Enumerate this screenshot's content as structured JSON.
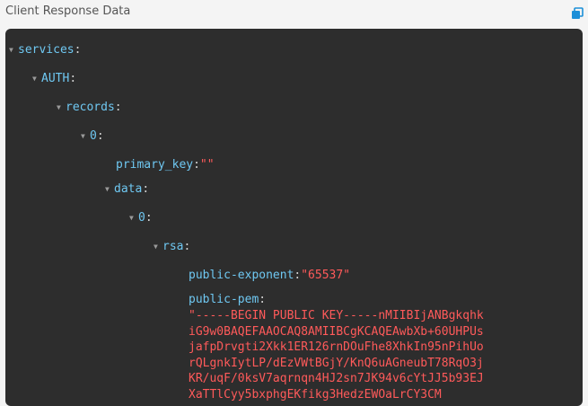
{
  "header": {
    "title": "Client Response Data",
    "copy_icon": "copy-icon"
  },
  "tree": {
    "services_key": "services",
    "auth_key": "AUTH",
    "records_key": "records",
    "index0_key": "0",
    "primary_key_key": "primary_key",
    "primary_key_value": "\"\"",
    "data_key": "data",
    "data_index0_key": "0",
    "rsa_key": "rsa",
    "public_exponent_key": "public-exponent",
    "public_exponent_value": "\"65537\"",
    "public_pem_key": "public-pem",
    "public_pem_value": "\"-----BEGIN PUBLIC KEY-----nMIIBIjANBgkqhkiG9w0BAQEFAAOCAQ8AMIIBCgKCAQEAwbXb+60UHPUsjafpDrvgti2Xkk1ER126rnDOuFhe8XhkIn95nPihUorQLgnkIytLP/dEzVWtBGjY/KnQ6uAGneubT78RqO3jKR/uqF/0ksV7aqrnqn4HJ2sn7JK94v6cYtJJ5b93EJXaTTlCyy5bxphgEKfikg3HedzEWOaLrCY3CM"
  },
  "colors": {
    "panel_bg": "#2d2d2d",
    "key": "#6fc8f2",
    "string": "#ff5a5a"
  }
}
